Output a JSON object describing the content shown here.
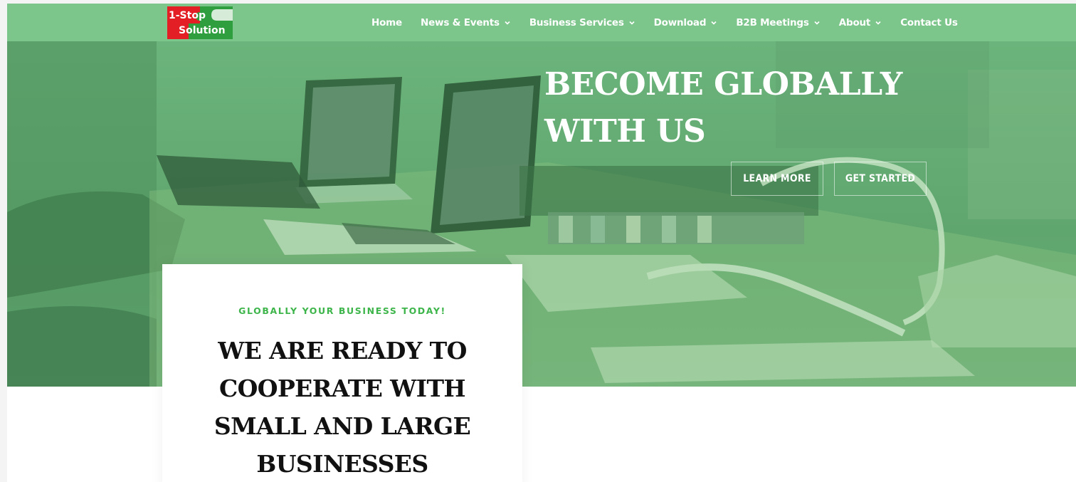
{
  "header": {
    "logo": {
      "line1": "1-Stop",
      "line2": "Solution"
    },
    "nav": [
      {
        "label": "Home",
        "has_dropdown": false
      },
      {
        "label": "News & Events",
        "has_dropdown": true
      },
      {
        "label": "Business Services",
        "has_dropdown": true
      },
      {
        "label": "Download",
        "has_dropdown": true
      },
      {
        "label": "B2B Meetings",
        "has_dropdown": true
      },
      {
        "label": "About",
        "has_dropdown": true
      },
      {
        "label": "Contact Us",
        "has_dropdown": false
      }
    ]
  },
  "hero": {
    "title_line1": "BECOME GLOBALLY",
    "title_line2": "WITH US",
    "learn_more": "LEARN MORE",
    "get_started": "GET STARTED"
  },
  "card": {
    "kicker": "GLOBALLY YOUR BUSINESS TODAY!",
    "title_line1": "WE ARE READY TO",
    "title_line2": "COOPERATE WITH",
    "title_line3": "SMALL AND LARGE",
    "title_line4": "BUSINESSES"
  },
  "colors": {
    "header_bg": "#7cc58b",
    "hero_tint": "#5fa66e",
    "accent_green": "#3db54a",
    "logo_red": "#e31e24"
  },
  "icons": [
    "chevron-down-icon"
  ]
}
